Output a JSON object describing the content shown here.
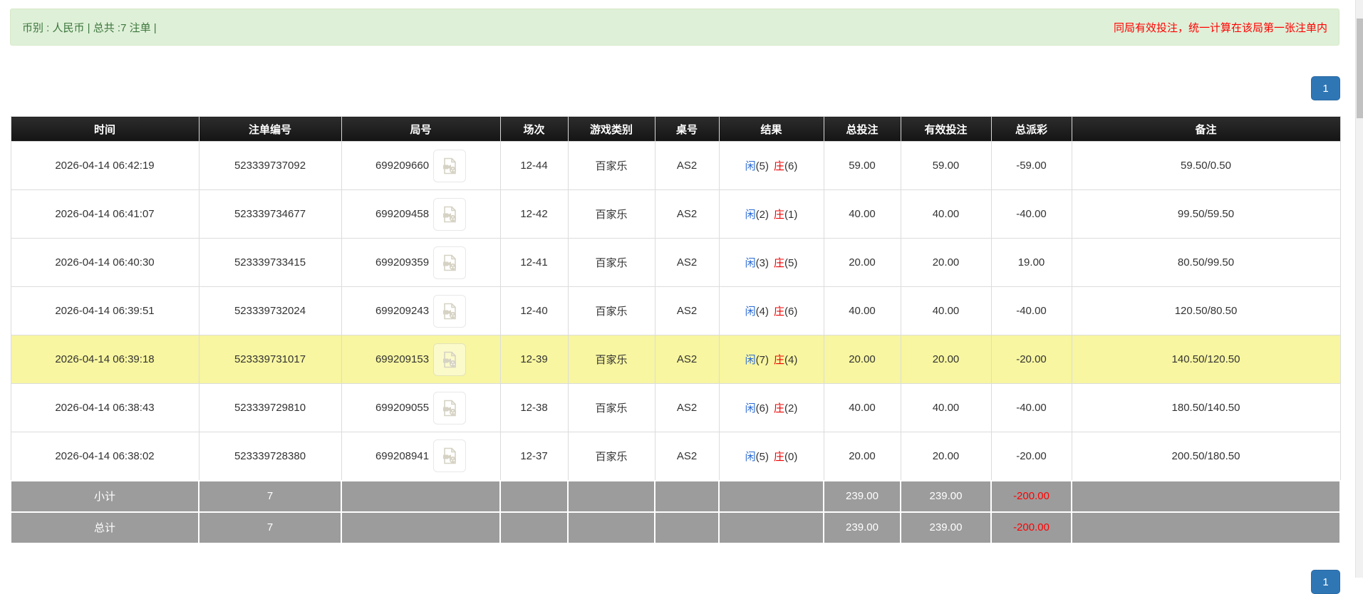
{
  "summary_bar": {
    "left_note": "币别 : 人民币 | 总共 :7 注单 |",
    "right_note": "同局有效投注，统一计算在该局第一张注单内"
  },
  "pagination": {
    "current_page": "1"
  },
  "table": {
    "columns": {
      "time": "时间",
      "bet_id": "注单编号",
      "round_id": "局号",
      "session": "场次",
      "game_type": "游戏类别",
      "table_no": "桌号",
      "result": "结果",
      "total_bet": "总投注",
      "valid_bet": "有效投注",
      "payout": "总派彩",
      "remark": "备注"
    },
    "rows": [
      {
        "time": "2026-04-14 06:42:19",
        "bet_id": "523339737092",
        "round_id": "699209660",
        "session": "12-44",
        "game_type": "百家乐",
        "table_no": "AS2",
        "player_label": "闲",
        "player_score": "(5)",
        "banker_label": "庄",
        "banker_score": "(6)",
        "total_bet": "59.00",
        "valid_bet": "59.00",
        "payout": "-59.00",
        "remark": "59.50/0.50",
        "highlighted": false
      },
      {
        "time": "2026-04-14 06:41:07",
        "bet_id": "523339734677",
        "round_id": "699209458",
        "session": "12-42",
        "game_type": "百家乐",
        "table_no": "AS2",
        "player_label": "闲",
        "player_score": "(2)",
        "banker_label": "庄",
        "banker_score": "(1)",
        "total_bet": "40.00",
        "valid_bet": "40.00",
        "payout": "-40.00",
        "remark": "99.50/59.50",
        "highlighted": false
      },
      {
        "time": "2026-04-14 06:40:30",
        "bet_id": "523339733415",
        "round_id": "699209359",
        "session": "12-41",
        "game_type": "百家乐",
        "table_no": "AS2",
        "player_label": "闲",
        "player_score": "(3)",
        "banker_label": "庄",
        "banker_score": "(5)",
        "total_bet": "20.00",
        "valid_bet": "20.00",
        "payout": "19.00",
        "remark": "80.50/99.50",
        "highlighted": false
      },
      {
        "time": "2026-04-14 06:39:51",
        "bet_id": "523339732024",
        "round_id": "699209243",
        "session": "12-40",
        "game_type": "百家乐",
        "table_no": "AS2",
        "player_label": "闲",
        "player_score": "(4)",
        "banker_label": "庄",
        "banker_score": "(6)",
        "total_bet": "40.00",
        "valid_bet": "40.00",
        "payout": "-40.00",
        "remark": "120.50/80.50",
        "highlighted": false
      },
      {
        "time": "2026-04-14 06:39:18",
        "bet_id": "523339731017",
        "round_id": "699209153",
        "session": "12-39",
        "game_type": "百家乐",
        "table_no": "AS2",
        "player_label": "闲",
        "player_score": "(7)",
        "banker_label": "庄",
        "banker_score": "(4)",
        "total_bet": "20.00",
        "valid_bet": "20.00",
        "payout": "-20.00",
        "remark": "140.50/120.50",
        "highlighted": true
      },
      {
        "time": "2026-04-14 06:38:43",
        "bet_id": "523339729810",
        "round_id": "699209055",
        "session": "12-38",
        "game_type": "百家乐",
        "table_no": "AS2",
        "player_label": "闲",
        "player_score": "(6)",
        "banker_label": "庄",
        "banker_score": "(2)",
        "total_bet": "40.00",
        "valid_bet": "40.00",
        "payout": "-40.00",
        "remark": "180.50/140.50",
        "highlighted": false
      },
      {
        "time": "2026-04-14 06:38:02",
        "bet_id": "523339728380",
        "round_id": "699208941",
        "session": "12-37",
        "game_type": "百家乐",
        "table_no": "AS2",
        "player_label": "闲",
        "player_score": "(5)",
        "banker_label": "庄",
        "banker_score": "(0)",
        "total_bet": "20.00",
        "valid_bet": "20.00",
        "payout": "-20.00",
        "remark": "200.50/180.50",
        "highlighted": false
      }
    ],
    "subtotal": {
      "label": "小计",
      "count": "7",
      "total_bet": "239.00",
      "valid_bet": "239.00",
      "payout": "-200.00"
    },
    "total": {
      "label": "总计",
      "count": "7",
      "total_bet": "239.00",
      "valid_bet": "239.00",
      "payout": "-200.00"
    }
  },
  "colors": {
    "alert_bg": "#dff0d8",
    "alert_text": "#3c763d",
    "warning_text": "#ff0000",
    "header_bg": "#1c1c1c",
    "highlight_row": "#f8f6a0",
    "summary_row_bg": "#9c9c9c",
    "link_blue": "#2a6bd4",
    "negative_red": "#ff0000",
    "pager_blue": "#2f76b5"
  },
  "icons": {
    "round_action": "video-replay-icon"
  }
}
